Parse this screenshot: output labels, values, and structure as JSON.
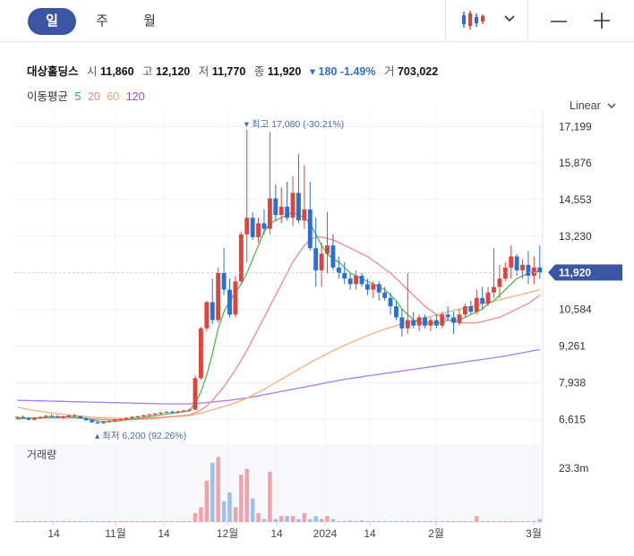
{
  "tabs": [
    {
      "label": "일",
      "active": true
    },
    {
      "label": "주",
      "active": false
    },
    {
      "label": "월",
      "active": false
    }
  ],
  "stock": {
    "name": "대상홀딩스",
    "open_label": "시",
    "open": "11,860",
    "high_label": "고",
    "high": "12,120",
    "low_label": "저",
    "low": "11,770",
    "close_label": "종",
    "close": "11,920",
    "change": "▾ 180 -1.49%",
    "volume_label": "거",
    "volume": "703,022"
  },
  "ma_label": "이동평균",
  "ma_periods": [
    {
      "period": "5",
      "color": "#2fae3a"
    },
    {
      "period": "20",
      "color": "#f07f7f"
    },
    {
      "period": "60",
      "color": "#f4a35c"
    },
    {
      "period": "120",
      "color": "#8a4fe6"
    }
  ],
  "scale_label": "Linear",
  "volume_panel_label": "거래량",
  "colors": {
    "up": "#e2423c",
    "down": "#2a6fd6",
    "accent": "#3a56a4"
  },
  "chart_data": {
    "type": "candlestick",
    "y_ticks": [
      "17,199",
      "15,876",
      "14,553",
      "13,230",
      "11,920",
      "10,584",
      "9,261",
      "7,938",
      "6,615"
    ],
    "y_tick_values": [
      17199,
      15876,
      14553,
      13230,
      11907,
      10584,
      9261,
      7938,
      6615
    ],
    "current_price": "11,920",
    "current_value": 11920,
    "ylim": [
      6300,
      17500
    ],
    "max_label": "최고 17,080 (-30.21%)",
    "max_value": 17080,
    "min_label": "최저 6,200 (92.26%)",
    "min_value": 6200,
    "x_ticks": [
      "14",
      "11월",
      "14",
      "12월",
      "14",
      "2024",
      "14",
      "2월",
      "3월"
    ],
    "volume_tick": "23.3m",
    "volume_max": 23.3,
    "candles": [
      [
        6660,
        6720,
        6600,
        6700
      ],
      [
        6700,
        6760,
        6640,
        6660
      ],
      [
        6660,
        6700,
        6570,
        6600
      ],
      [
        6600,
        6690,
        6570,
        6660
      ],
      [
        6660,
        6720,
        6620,
        6700
      ],
      [
        6700,
        6780,
        6650,
        6740
      ],
      [
        6740,
        6800,
        6690,
        6720
      ],
      [
        6720,
        6780,
        6660,
        6680
      ],
      [
        6680,
        6740,
        6630,
        6720
      ],
      [
        6720,
        6780,
        6680,
        6750
      ],
      [
        6750,
        6800,
        6700,
        6720
      ],
      [
        6720,
        6760,
        6640,
        6660
      ],
      [
        6660,
        6700,
        6560,
        6580
      ],
      [
        6580,
        6630,
        6480,
        6510
      ],
      [
        6510,
        6560,
        6440,
        6470
      ],
      [
        6470,
        6540,
        6450,
        6520
      ],
      [
        6520,
        6580,
        6490,
        6560
      ],
      [
        6560,
        6620,
        6520,
        6600
      ],
      [
        6600,
        6650,
        6560,
        6620
      ],
      [
        6620,
        6690,
        6590,
        6660
      ],
      [
        6660,
        6720,
        6620,
        6700
      ],
      [
        6700,
        6750,
        6660,
        6720
      ],
      [
        6720,
        6780,
        6690,
        6760
      ],
      [
        6760,
        6810,
        6720,
        6790
      ],
      [
        6790,
        6850,
        6750,
        6820
      ],
      [
        6820,
        6880,
        6790,
        6850
      ],
      [
        6850,
        6910,
        6810,
        6880
      ],
      [
        6880,
        6930,
        6830,
        6860
      ],
      [
        6860,
        6920,
        6820,
        6900
      ],
      [
        6900,
        6960,
        6860,
        6930
      ],
      [
        6930,
        7000,
        6890,
        6960
      ],
      [
        6960,
        8200,
        6950,
        8100
      ],
      [
        8100,
        9950,
        8050,
        9900
      ],
      [
        9900,
        10900,
        9800,
        10850
      ],
      [
        10850,
        11700,
        10050,
        10200
      ],
      [
        10200,
        12100,
        10100,
        11900
      ],
      [
        11900,
        12800,
        11100,
        11300
      ],
      [
        11300,
        11700,
        10300,
        10400
      ],
      [
        10400,
        11800,
        10300,
        11600
      ],
      [
        11600,
        13400,
        11500,
        13300
      ],
      [
        13300,
        17080,
        12300,
        13900
      ],
      [
        13900,
        14100,
        13100,
        13200
      ],
      [
        13200,
        13900,
        13000,
        13700
      ],
      [
        13700,
        14200,
        13300,
        13500
      ],
      [
        13500,
        17000,
        13300,
        14600
      ],
      [
        14600,
        15100,
        13800,
        14000
      ],
      [
        14000,
        15000,
        13700,
        14300
      ],
      [
        14300,
        15200,
        13800,
        13900
      ],
      [
        13900,
        15400,
        13600,
        14800
      ],
      [
        14800,
        16200,
        13700,
        13800
      ],
      [
        13800,
        15800,
        13500,
        14200
      ],
      [
        14200,
        15200,
        12700,
        12800
      ],
      [
        12800,
        13900,
        11400,
        12000
      ],
      [
        12000,
        13000,
        11400,
        12600
      ],
      [
        12600,
        14100,
        11900,
        12900
      ],
      [
        12900,
        13300,
        12000,
        12100
      ],
      [
        12100,
        12500,
        11700,
        11900
      ],
      [
        11900,
        12300,
        11500,
        11700
      ],
      [
        11700,
        11900,
        11300,
        11500
      ],
      [
        11500,
        12000,
        11300,
        11800
      ],
      [
        11800,
        11900,
        11400,
        11500
      ],
      [
        11500,
        11700,
        11100,
        11300
      ],
      [
        11300,
        11600,
        11000,
        11500
      ],
      [
        11500,
        11600,
        10900,
        11200
      ],
      [
        11200,
        11400,
        10900,
        11000
      ],
      [
        11000,
        11200,
        10400,
        10700
      ],
      [
        10700,
        10900,
        10200,
        10300
      ],
      [
        10300,
        10600,
        9600,
        9900
      ],
      [
        9900,
        11900,
        9700,
        10200
      ],
      [
        10200,
        10500,
        9900,
        10000
      ],
      [
        10000,
        10400,
        9800,
        10300
      ],
      [
        10300,
        10400,
        9900,
        10000
      ],
      [
        10000,
        10300,
        9800,
        10200
      ],
      [
        10200,
        10400,
        9900,
        10000
      ],
      [
        10000,
        10500,
        9900,
        10400
      ],
      [
        10400,
        10700,
        10200,
        10300
      ],
      [
        10300,
        10500,
        9700,
        10100
      ],
      [
        10100,
        10600,
        10000,
        10400
      ],
      [
        10400,
        10800,
        10300,
        10700
      ],
      [
        10700,
        10900,
        10400,
        10500
      ],
      [
        10500,
        11300,
        10400,
        11000
      ],
      [
        11000,
        11400,
        10600,
        10800
      ],
      [
        10800,
        11400,
        10700,
        11200
      ],
      [
        11200,
        12800,
        11000,
        11400
      ],
      [
        11400,
        12200,
        11000,
        11700
      ],
      [
        11700,
        12300,
        11600,
        12100
      ],
      [
        12100,
        12900,
        11700,
        12500
      ],
      [
        12500,
        12600,
        11800,
        12000
      ],
      [
        12000,
        12400,
        11700,
        12200
      ],
      [
        12200,
        12700,
        11500,
        11800
      ],
      [
        11800,
        12500,
        11500,
        12100
      ],
      [
        12100,
        12900,
        11700,
        11920
      ]
    ],
    "ma5": [
      6620,
      6640,
      6650,
      6660,
      6670,
      6680,
      6690,
      6700,
      6700,
      6700,
      6690,
      6670,
      6640,
      6600,
      6560,
      6540,
      6530,
      6540,
      6560,
      6590,
      6620,
      6650,
      6680,
      6710,
      6740,
      6770,
      6800,
      6830,
      6860,
      6890,
      6920,
      7200,
      7600,
      8200,
      9000,
      9900,
      10500,
      10900,
      11200,
      11500,
      11900,
      12400,
      12900,
      13400,
      13700,
      13800,
      13900,
      14000,
      14100,
      14000,
      13900,
      13700,
      13300,
      12900,
      12600,
      12400,
      12300,
      12100,
      11900,
      11800,
      11700,
      11600,
      11500,
      11400,
      11300,
      11100,
      10900,
      10600,
      10400,
      10200,
      10100,
      10100,
      10100,
      10100,
      10100,
      10200,
      10200,
      10200,
      10300,
      10400,
      10500,
      10600,
      10800,
      10900,
      11100,
      11300,
      11500,
      11700,
      11800,
      11900,
      11950,
      11950
    ],
    "ma20": [
      6660,
      6660,
      6660,
      6660,
      6660,
      6660,
      6660,
      6660,
      6660,
      6660,
      6660,
      6650,
      6640,
      6630,
      6620,
      6610,
      6600,
      6600,
      6600,
      6600,
      6600,
      6610,
      6620,
      6630,
      6650,
      6670,
      6690,
      6710,
      6730,
      6750,
      6770,
      6850,
      6950,
      7100,
      7300,
      7550,
      7800,
      8100,
      8400,
      8750,
      9100,
      9500,
      9900,
      10300,
      10700,
      11100,
      11500,
      11900,
      12300,
      12600,
      12900,
      13100,
      13200,
      13200,
      13150,
      13100,
      13000,
      12900,
      12800,
      12700,
      12600,
      12500,
      12350,
      12200,
      12050,
      11900,
      11700,
      11500,
      11300,
      11100,
      10900,
      10700,
      10550,
      10400,
      10300,
      10200,
      10150,
      10100,
      10100,
      10100,
      10100,
      10150,
      10200,
      10250,
      10300,
      10400,
      10500,
      10600,
      10700,
      10800,
      10950,
      11100
    ],
    "ma60": [
      7050,
      7010,
      6970,
      6930,
      6900,
      6870,
      6840,
      6810,
      6790,
      6770,
      6750,
      6730,
      6710,
      6690,
      6680,
      6670,
      6660,
      6650,
      6650,
      6650,
      6650,
      6650,
      6660,
      6670,
      6680,
      6690,
      6700,
      6710,
      6720,
      6730,
      6750,
      6790,
      6840,
      6900,
      6960,
      7020,
      7080,
      7140,
      7210,
      7290,
      7380,
      7480,
      7590,
      7700,
      7820,
      7940,
      8060,
      8180,
      8300,
      8420,
      8540,
      8660,
      8770,
      8880,
      8990,
      9090,
      9190,
      9290,
      9380,
      9470,
      9560,
      9640,
      9720,
      9800,
      9870,
      9940,
      10000,
      10060,
      10120,
      10170,
      10230,
      10280,
      10340,
      10390,
      10440,
      10490,
      10540,
      10590,
      10640,
      10690,
      10740,
      10790,
      10840,
      10890,
      10940,
      10990,
      11040,
      11090,
      11140,
      11190,
      11250,
      11300
    ],
    "ma120": [
      7300,
      7295,
      7290,
      7285,
      7280,
      7275,
      7270,
      7265,
      7260,
      7255,
      7250,
      7245,
      7240,
      7235,
      7230,
      7225,
      7220,
      7215,
      7210,
      7205,
      7200,
      7195,
      7190,
      7185,
      7180,
      7175,
      7170,
      7170,
      7170,
      7170,
      7170,
      7180,
      7200,
      7220,
      7240,
      7260,
      7280,
      7300,
      7330,
      7360,
      7390,
      7420,
      7460,
      7500,
      7540,
      7580,
      7620,
      7660,
      7700,
      7740,
      7780,
      7820,
      7860,
      7900,
      7940,
      7980,
      8020,
      8060,
      8090,
      8120,
      8150,
      8180,
      8210,
      8240,
      8270,
      8300,
      8330,
      8360,
      8390,
      8420,
      8450,
      8480,
      8510,
      8540,
      8570,
      8600,
      8630,
      8660,
      8690,
      8720,
      8750,
      8780,
      8810,
      8840,
      8870,
      8900,
      8940,
      8980,
      9020,
      9060,
      9100,
      9140
    ],
    "volume": [
      0.2,
      0.2,
      0.2,
      0.2,
      0.2,
      0.2,
      0.2,
      0.2,
      0.2,
      0.2,
      0.2,
      0.2,
      0.2,
      0.2,
      0.2,
      0.2,
      0.2,
      0.2,
      0.2,
      0.2,
      0.2,
      0.2,
      0.2,
      0.2,
      0.2,
      0.2,
      0.2,
      0.2,
      0.2,
      0.2,
      0.2,
      3,
      5,
      14,
      20,
      22,
      7,
      10,
      5,
      16,
      18,
      8,
      3,
      1,
      17,
      1,
      2,
      2,
      2,
      1,
      3,
      1,
      2,
      1,
      2,
      1,
      0.3,
      0.3,
      0.5,
      0.3,
      0.5,
      0.3,
      0.3,
      0.3,
      0.3,
      0.3,
      0.3,
      0.3,
      0.3,
      0.3,
      0.3,
      0.3,
      0.3,
      0.3,
      0.3,
      0.3,
      0.3,
      0.3,
      0.3,
      0.3,
      2,
      0.3,
      0.3,
      0.3,
      0.3,
      0.3,
      0.3,
      0.3,
      0.3,
      0.3,
      0.3,
      1
    ]
  }
}
